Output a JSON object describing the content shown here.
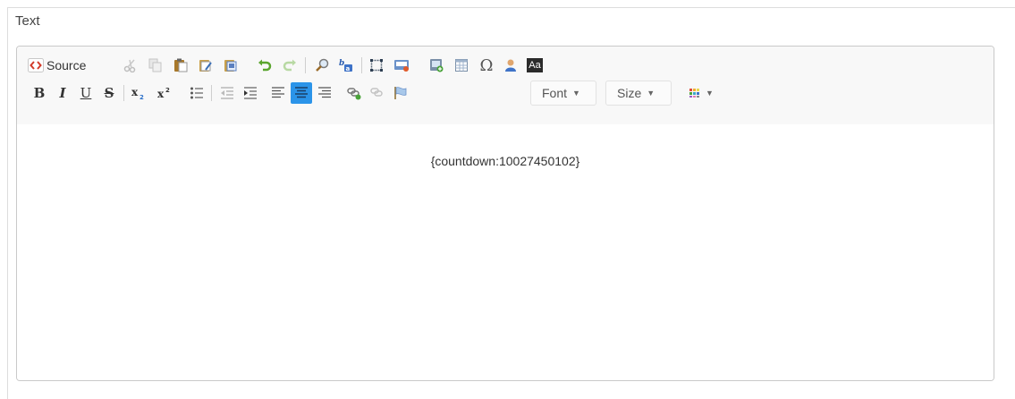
{
  "field": {
    "label": "Text"
  },
  "toolbar": {
    "source_label": "Source",
    "font_label": "Font",
    "size_label": "Size",
    "special_char_label": "Ω",
    "aa_label": "Aa",
    "bold_label": "B",
    "italic_label": "I",
    "underline_label": "U",
    "strike_label": "S"
  },
  "editor": {
    "content": "{countdown:10027450102}"
  },
  "colors": {
    "active_button": "#2b94e9"
  }
}
